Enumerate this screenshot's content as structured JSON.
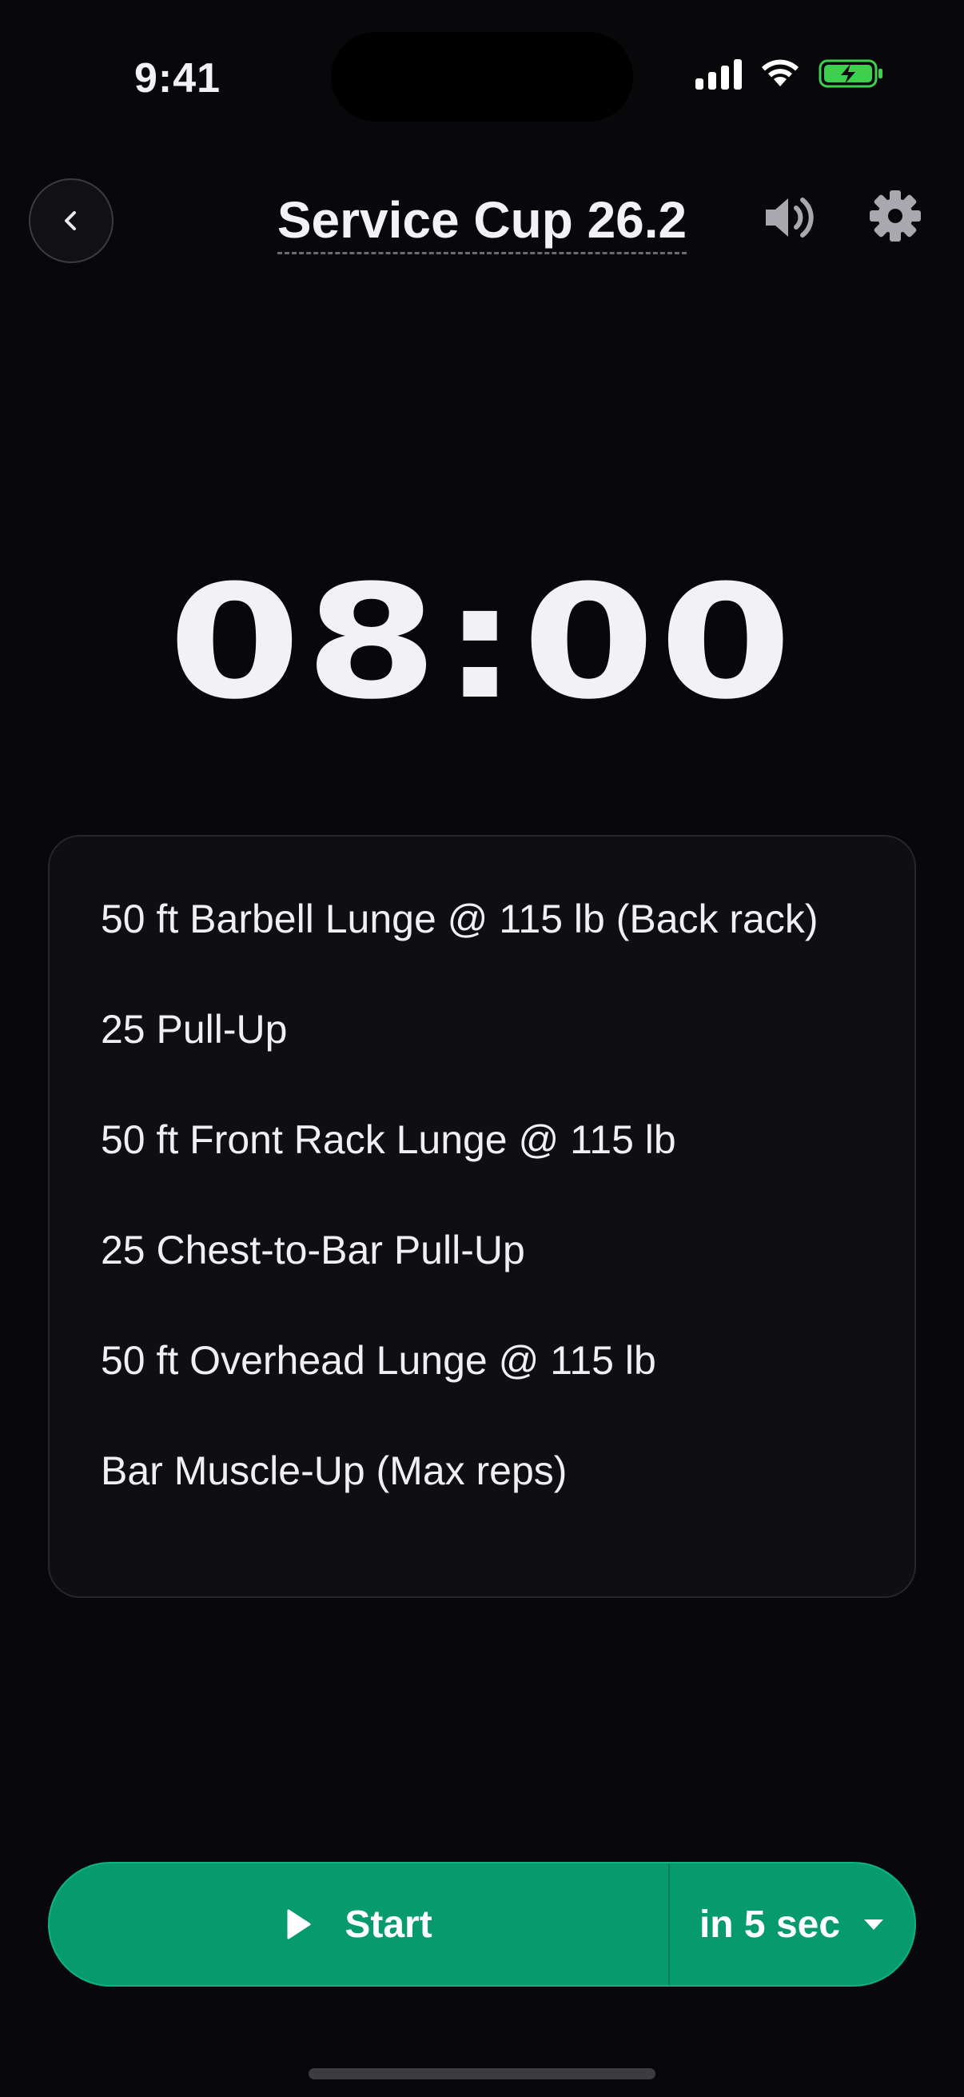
{
  "status": {
    "time": "9:41"
  },
  "header": {
    "title": "Service Cup 26.2"
  },
  "timer": {
    "display": "08:00"
  },
  "workout": {
    "items": [
      "50 ft Barbell Lunge @ 115 lb (Back rack)",
      "25 Pull-Up",
      "50 ft Front Rack Lunge @ 115 lb",
      "25 Chest-to-Bar Pull-Up",
      "50 ft Overhead Lunge @ 115 lb",
      "Bar Muscle-Up (Max reps)"
    ]
  },
  "controls": {
    "start_label": "Start",
    "delay_label": "in 5 sec"
  },
  "icons": {
    "back": "chevron-left-icon",
    "speaker": "speaker-icon",
    "settings": "gear-icon",
    "play": "play-icon",
    "dropdown": "caret-down-icon"
  },
  "colors": {
    "accent": "#069a6c",
    "background": "#08080a",
    "battery": "#3ecf4e"
  }
}
